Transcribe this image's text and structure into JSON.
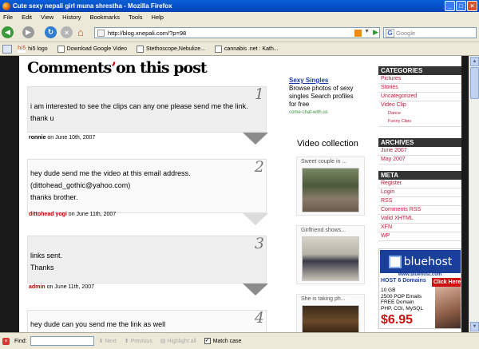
{
  "window": {
    "title": "Cute sexy nepali girl muna shrestha - Mozilla Firefox"
  },
  "menu": [
    "File",
    "Edit",
    "View",
    "History",
    "Bookmarks",
    "Tools",
    "Help"
  ],
  "nav": {
    "url": "http://blog.xnepali.com/?p=98",
    "search_engine": "G",
    "search_placeholder": "Google"
  },
  "bookmarks": [
    "hi5 logo",
    "Download Google Video",
    "Stethoscope,Nebulize...",
    "cannabis .net : Kath..."
  ],
  "page": {
    "title_a": "Comments",
    "title_b": "on this post",
    "comments": [
      {
        "num": "1",
        "lines": [
          "i am interested to see the clips can any one please send me the link.",
          "thank u"
        ],
        "author": "ronnie",
        "date": "on June 10th, 2007"
      },
      {
        "num": "2",
        "lines": [
          "hey dude send me the video at this email address.",
          "(dittohead_gothic@yahoo.com)",
          "thanks brother."
        ],
        "author": "dittohead yogi",
        "date": "on June 11th, 2007"
      },
      {
        "num": "3",
        "lines": [
          "links sent.",
          "Thanks"
        ],
        "author": "admin",
        "date": "on June 11th, 2007"
      },
      {
        "num": "4",
        "lines": [
          "hey dude can you send me the link as well"
        ],
        "author": "",
        "date": ""
      }
    ],
    "ad": {
      "title": "Sexy Singles",
      "body": "Browse photos of sexy singles Search profiles for free",
      "url": "come-chat-with.us"
    },
    "video_collection": {
      "heading": "Video collection",
      "items": [
        "Sweet couple in ...",
        "Girlfriend shows...",
        "She is taking ph..."
      ]
    },
    "sidebar": {
      "categories": {
        "heading": "CATEGORIES",
        "items": [
          "Pictures",
          "Stories",
          "Uncategorized",
          "Video Clip"
        ],
        "subitems": [
          "Dance",
          "Funny Clips"
        ]
      },
      "archives": {
        "heading": "ARCHIVES",
        "items": [
          "June 2007",
          "May 2007"
        ]
      },
      "meta": {
        "heading": "META",
        "items": [
          "Register",
          "Login",
          "RSS",
          "Comments RSS",
          "Valid XHTML",
          "XFN",
          "WP"
        ]
      }
    },
    "bluehost": {
      "brand": "bluehost",
      "url": "www.bluehost.com",
      "host": "HOST 6 Domains",
      "click": "Click Here",
      "features": [
        "10 GB",
        "2500 POP Emails",
        "FREE Domain",
        "PHP, CGI, MySQL"
      ],
      "price": "$6.95"
    }
  },
  "find": {
    "label": "Find:",
    "next": "Next",
    "previous": "Previous",
    "highlight": "Highlight all",
    "match_case": "Match case"
  }
}
